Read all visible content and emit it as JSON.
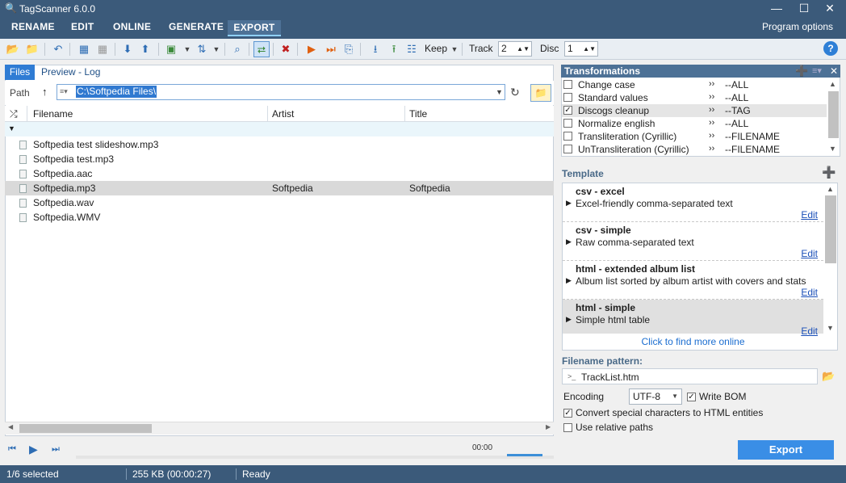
{
  "window": {
    "title": "TagScanner 6.0.0"
  },
  "menu": {
    "items": [
      "RENAME",
      "EDIT",
      "ONLINE",
      "GENERATE",
      "EXPORT"
    ],
    "right": "Program options"
  },
  "toolbar": {
    "keep": "Keep",
    "track_label": "Track",
    "track_value": "2",
    "disc_label": "Disc",
    "disc_value": "1"
  },
  "left": {
    "tabs": [
      "Files",
      "Preview - Log"
    ],
    "path_label": "Path",
    "path_value": "C:\\Softpedia Files\\",
    "columns": [
      "Filename",
      "Artist",
      "Title"
    ],
    "rows": [
      {
        "filename": "Softpedia test slideshow.mp3",
        "artist": "",
        "title": ""
      },
      {
        "filename": "Softpedia test.mp3",
        "artist": "",
        "title": ""
      },
      {
        "filename": "Softpedia.aac",
        "artist": "",
        "title": ""
      },
      {
        "filename": "Softpedia.mp3",
        "artist": "Softpedia",
        "title": "Softpedia"
      },
      {
        "filename": "Softpedia.wav",
        "artist": "",
        "title": ""
      },
      {
        "filename": "Softpedia.WMV",
        "artist": "",
        "title": ""
      }
    ]
  },
  "player": {
    "time": "00:00"
  },
  "transformations": {
    "title": "Transformations",
    "items": [
      {
        "name": "Change case",
        "scope": "--ALL",
        "checked": false
      },
      {
        "name": "Standard values",
        "scope": "--ALL",
        "checked": false
      },
      {
        "name": "Discogs cleanup",
        "scope": "--TAG",
        "checked": true
      },
      {
        "name": "Normalize english",
        "scope": "--ALL",
        "checked": false
      },
      {
        "name": "Transliteration (Cyrillic)",
        "scope": "--FILENAME",
        "checked": false
      },
      {
        "name": "UnTransliteration (Cyrillic)",
        "scope": "--FILENAME",
        "checked": false
      }
    ]
  },
  "template": {
    "label": "Template",
    "items": [
      {
        "title": "csv - excel",
        "desc": "Excel-friendly comma-separated text",
        "edit": "Edit"
      },
      {
        "title": "csv - simple",
        "desc": "Raw comma-separated text",
        "edit": "Edit"
      },
      {
        "title": "html - extended album list",
        "desc": "Album list sorted by album artist with covers and stats",
        "edit": "Edit"
      },
      {
        "title": "html - simple",
        "desc": "Simple html table",
        "edit": "Edit"
      }
    ],
    "find_more": "Click to find more online"
  },
  "filename_pattern": {
    "label": "Filename pattern:",
    "value": "TrackList.htm"
  },
  "encoding": {
    "label": "Encoding",
    "value": "UTF-8"
  },
  "options": {
    "write_bom": "Write BOM",
    "convert_special": "Convert special characters to HTML entities",
    "relative_paths": "Use relative paths"
  },
  "export_label": "Export",
  "status": {
    "selected": "1/6 selected",
    "size": "255 KB (00:00:27)",
    "state": "Ready"
  },
  "colors": {
    "title_bg": "#3b5a7a",
    "accent": "#3a8ee6"
  }
}
